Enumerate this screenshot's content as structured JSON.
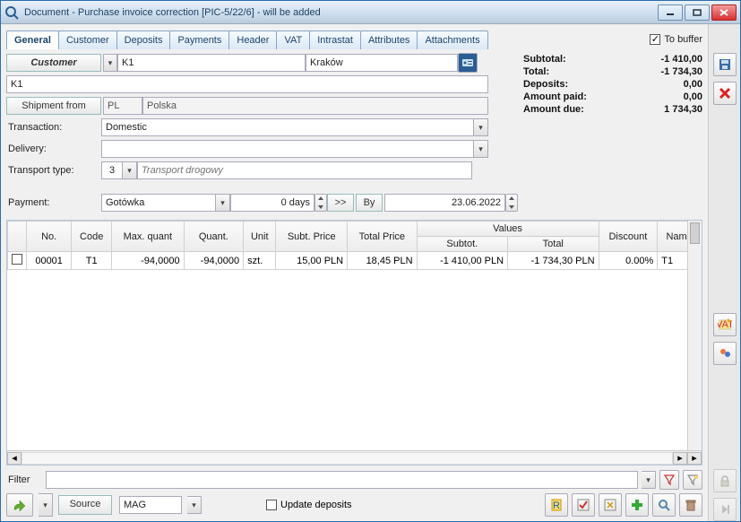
{
  "window": {
    "title": "Document - Purchase invoice correction [PIC-5/22/6]  - will be added"
  },
  "tabs": [
    "General",
    "Customer",
    "Deposits",
    "Payments",
    "Header",
    "VAT",
    "Intrastat",
    "Attributes",
    "Attachments"
  ],
  "to_buffer_label": "To buffer",
  "customer": {
    "btn": "Customer",
    "code": "K1",
    "city": "Kraków",
    "name": "K1"
  },
  "shipment": {
    "btn": "Shipment from",
    "code": "PL",
    "name": "Polska"
  },
  "labels": {
    "transaction": "Transaction:",
    "delivery": "Delivery:",
    "transport": "Transport type:",
    "payment": "Payment:",
    "filter": "Filter",
    "source": "Source",
    "update_deposits": "Update deposits"
  },
  "transaction": "Domestic",
  "delivery": "",
  "transport": {
    "value": "3",
    "placeholder": "Transport drogowy"
  },
  "payment": {
    "method": "Gotówka",
    "days": "0 days",
    "fwd": ">>",
    "by": "By",
    "date": "23.06.2022"
  },
  "totals": {
    "subtotal_lbl": "Subtotal:",
    "subtotal_val": "-1 410,00",
    "total_lbl": "Total:",
    "total_val": "-1 734,30",
    "deposits_lbl": "Deposits:",
    "deposits_val": "0,00",
    "paid_lbl": "Amount paid:",
    "paid_val": "0,00",
    "due_lbl": "Amount due:",
    "due_val": "1 734,30"
  },
  "grid": {
    "group_header": "Values",
    "cols": [
      "No.",
      "Code",
      "Max. quant",
      "Quant.",
      "Unit",
      "Subt. Price",
      "Total Price",
      "Subtot.",
      "Total",
      "Discount",
      "Name"
    ],
    "rows": [
      {
        "no": "00001",
        "code": "T1",
        "maxq": "-94,0000",
        "q": "-94,0000",
        "unit": "szt.",
        "subp": "15,00 PLN",
        "totp": "18,45 PLN",
        "subtot": "-1 410,00 PLN",
        "total": "-1 734,30 PLN",
        "disc": "0.00%",
        "name": "T1"
      }
    ]
  },
  "source_value": "MAG"
}
